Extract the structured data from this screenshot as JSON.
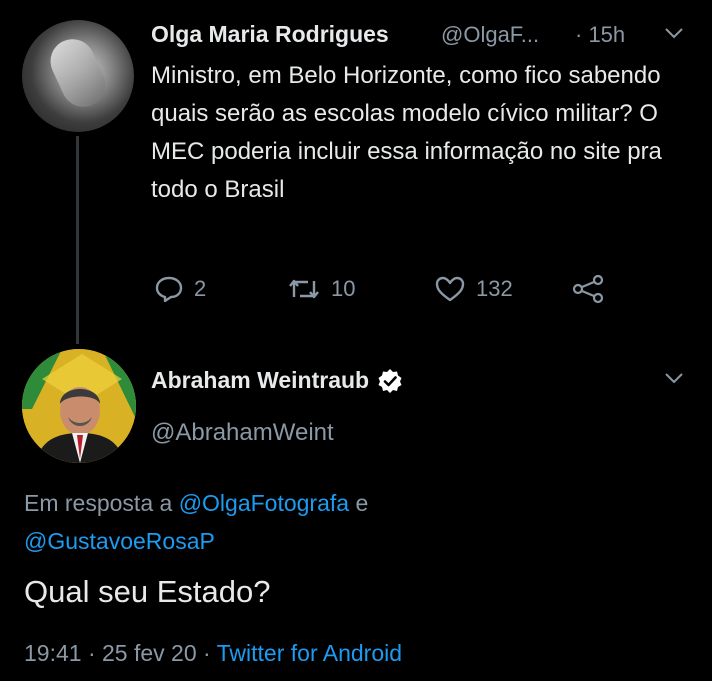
{
  "tweet1": {
    "name": "Olga Maria Rodrigues",
    "handle": "@OlgaF...",
    "time": "· 15h",
    "text": "Ministro, em Belo Horizonte, como fico sabendo quais serão as escolas modelo cívico militar? O MEC poderia incluir essa informação no site pra todo o Brasil",
    "replies": "2",
    "retweets": "10",
    "likes": "132"
  },
  "tweet2": {
    "name": "Abraham Weintraub",
    "handle": "@AbrahamWeint",
    "reply_prefix": "Em resposta a ",
    "mention1": "@OlgaFotografa",
    "mention_joiner": " e ",
    "mention2": "@GustavoeRosaP",
    "text": "Qual seu Estado?",
    "datetime": "19:41 · 25 fev 20 · ",
    "source": "Twitter for Android"
  },
  "colors": {
    "background": "#000000",
    "text": "#e7e9ea",
    "muted": "#8b98a5",
    "link": "#1d9bf0",
    "verified": "#ffffff"
  },
  "icons": [
    "reply-icon",
    "retweet-icon",
    "like-icon",
    "share-icon",
    "caret-down-icon",
    "verified-badge-icon"
  ]
}
